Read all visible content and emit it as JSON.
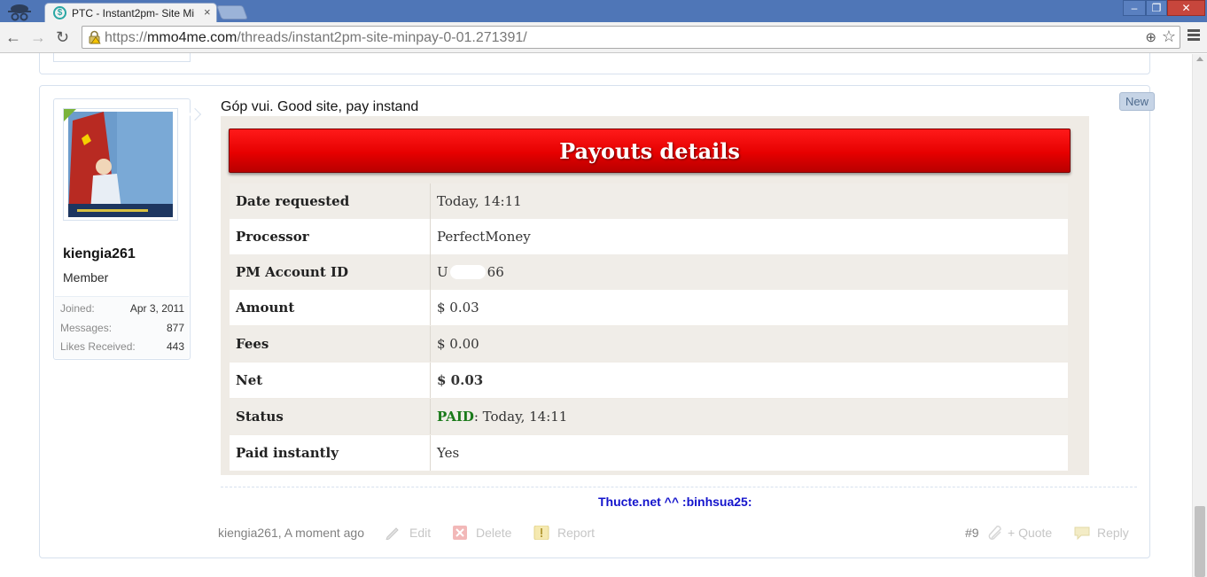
{
  "browser": {
    "tab_title": "PTC - Instant2pm- Site Mi",
    "tab_close": "×",
    "url_prefix": "https://",
    "url_host": "mmo4me.com",
    "url_path": "/threads/instant2pm-site-minpay-0-01.271391/",
    "window_minimize": "–",
    "window_restore": "❐",
    "window_close": "✕"
  },
  "post": {
    "new_badge": "New",
    "message": "Góp vui. Good site, pay instand",
    "signature": "Thucte.net ^^ :binhsua25:",
    "user": {
      "name": "kiengia261",
      "title": "Member",
      "stats": [
        {
          "label": "Joined:",
          "value": "Apr 3, 2011"
        },
        {
          "label": "Messages:",
          "value": "877"
        },
        {
          "label": "Likes Received:",
          "value": "443"
        }
      ]
    },
    "footer": {
      "author_time": "kiengia261, A moment ago",
      "edit": "Edit",
      "delete": "Delete",
      "report": "Report",
      "post_number": "#9",
      "quote": "+ Quote",
      "reply": "Reply"
    }
  },
  "payout": {
    "title": "Payouts details",
    "rows": [
      {
        "label": "Date requested",
        "value": "Today, 14:11"
      },
      {
        "label": "Processor",
        "value": "PerfectMoney"
      },
      {
        "label": "PM Account ID",
        "value_start": "U",
        "value_end": "66"
      },
      {
        "label": "Amount",
        "value": "$ 0.03"
      },
      {
        "label": "Fees",
        "value": "$ 0.00"
      },
      {
        "label": "Net",
        "value": "$ 0.03"
      },
      {
        "label": "Status",
        "status_word": "PAID",
        "value": ": Today, 14:11"
      },
      {
        "label": "Paid instantly",
        "value": "Yes"
      }
    ]
  },
  "colors": {
    "title_bar": "#4f76b7",
    "banner_red": "#e60000",
    "paid_green": "#1a7a1a",
    "signature_blue": "#1414cc"
  }
}
